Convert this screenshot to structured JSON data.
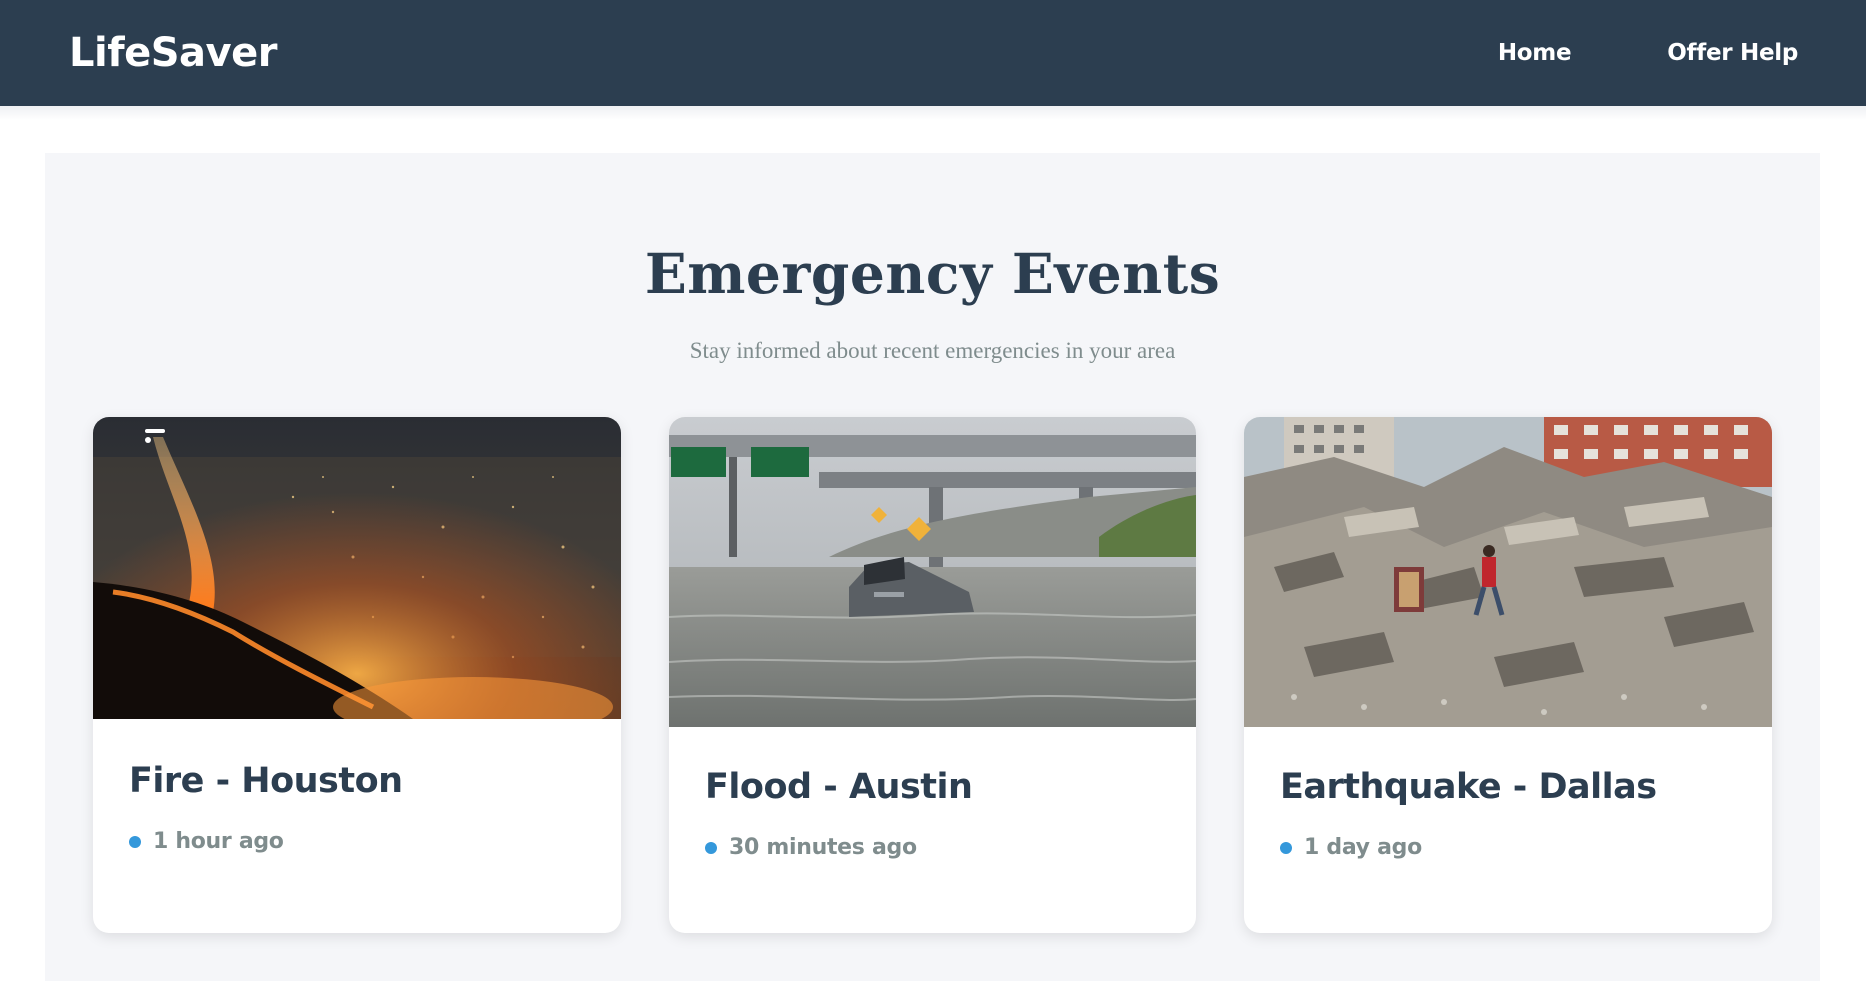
{
  "navbar": {
    "brand": "LifeSaver",
    "links": [
      {
        "label": "Home"
      },
      {
        "label": "Offer Help"
      }
    ]
  },
  "events_section": {
    "title": "Emergency Events",
    "subtitle": "Stay informed about recent emergencies in your area"
  },
  "events": [
    {
      "title": "Fire - Houston",
      "time": "1 hour ago",
      "image": "wildfire-photo"
    },
    {
      "title": "Flood - Austin",
      "time": "30 minutes ago",
      "image": "flooded-highway-photo"
    },
    {
      "title": "Earthquake - Dallas",
      "time": "1 day ago",
      "image": "collapsed-building-photo"
    }
  ],
  "colors": {
    "navbar_bg": "#2c3e50",
    "title_text": "#2c3e50",
    "muted_text": "#7f8c8d",
    "accent_dot": "#3498db",
    "section_bg": "#f5f6f9"
  }
}
